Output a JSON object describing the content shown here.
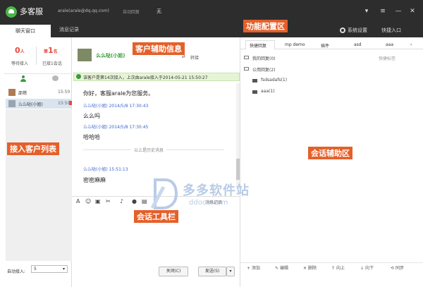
{
  "window": {
    "app_title": "多客服",
    "account": "arale(arale@dq.qq.com)",
    "status": "自动回复",
    "status_option": "无"
  },
  "tabs": {
    "chat": "聊天窗口",
    "history": "消息记录"
  },
  "toolbar": {
    "settings": "系统设置",
    "quick_access": "快捷入口"
  },
  "left": {
    "waiting_count": "0",
    "waiting_unit": "人",
    "waiting_label": "等待接入",
    "rank_prefix": "第",
    "rank": "1",
    "rank_suffix": "名",
    "accepted_label": "已接1会话",
    "users": [
      {
        "name": "邵燃",
        "time": "15:50"
      },
      {
        "name": "么么哒(小姐)",
        "time": "15:50"
      }
    ],
    "auto_accept_label": "自动接入:",
    "auto_accept_value": "5"
  },
  "chat": {
    "customer_name": "么么哒(小姐)",
    "transfer": "转接",
    "notice": "该客户是第14次接入，上次由arale接入于2014-05-21 15:50:27",
    "messages": [
      {
        "name": "",
        "text": "你好，客服arale为您服务。"
      },
      {
        "name": "么么哒(小姐) 2014/5/8 17:30:43",
        "text": "么么吗"
      },
      {
        "name": "么么哒(小姐) 2014/5/8 17:30:45",
        "text": "哈哈哈"
      },
      {
        "name": "么么哒(小姐) 15:51:13",
        "text": "密密麻麻"
      }
    ],
    "history_label": "以上是历史消息",
    "msg_record": "消息记录",
    "close_btn": "关闭(C)",
    "send_btn": "发送(S)"
  },
  "right": {
    "tabs": [
      "快捷回复",
      "mp demo",
      "插件",
      "asd",
      "aaa"
    ],
    "my_reply": "我的回复(0)",
    "public_reply": "公用回复(2)",
    "folder1": "fsdsadafs(1)",
    "folder2": "aaa(1)",
    "quick_label": "快捷标签",
    "actions": [
      "添加",
      "编辑",
      "删除",
      "向上",
      "向下",
      "同步"
    ]
  },
  "annotations": {
    "customer_info": "客户辅助信息",
    "function_config": "功能配置区",
    "customer_list": "接入客户列表",
    "session_assist": "会话辅助区",
    "session_tools": "会话工具栏"
  },
  "watermark": {
    "brand": "多多软件站",
    "domain": "ddooo.com"
  },
  "colors": {
    "titlebar": "#2d2d2d",
    "accent_red": "#e64a3c",
    "accent_green": "#3a9a3a",
    "annotation_orange": "#e4602a",
    "link_blue": "#3b65c8"
  }
}
